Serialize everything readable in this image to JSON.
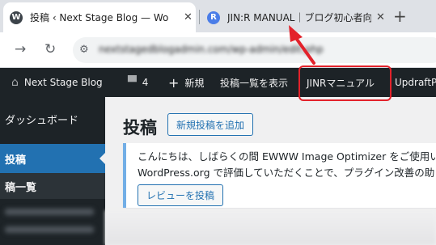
{
  "browser": {
    "tabs": [
      {
        "title": "投稿 ‹ Next Stage Blog — Wo",
        "favicon": "wordpress-icon",
        "active": true,
        "close": "✕"
      },
      {
        "title": "JIN:R MANUAL｜ブログ初心者向",
        "favicon": "jinr-icon",
        "active": false,
        "close": "✕"
      }
    ],
    "new_tab": "+",
    "url": "nextstagedblogadmin.com/wp-admin/edit.php"
  },
  "adminbar": {
    "site_name": "Next Stage Blog",
    "comments_count": "4",
    "new_label": "新規",
    "view_posts": "投稿一覧を表示",
    "jinr_manual": "JINRマニュアル",
    "updraft": "UpdraftPl"
  },
  "sidebar": {
    "dashboard": "ダッシュボード",
    "posts": "投稿",
    "posts_list": "稿一覧"
  },
  "main": {
    "title": "投稿",
    "add_new": "新規投稿を追加",
    "notice_line1": "こんにちは、しばらくの間 EWWW Image Optimizer をご使用い",
    "notice_line2": "WordPress.org で評価していただくことで、プラグイン改善の助",
    "review_button": "レビューを投稿"
  },
  "colors": {
    "admin_bar": "#1d2327",
    "accent": "#2271b1",
    "annotation": "#e3222b"
  }
}
